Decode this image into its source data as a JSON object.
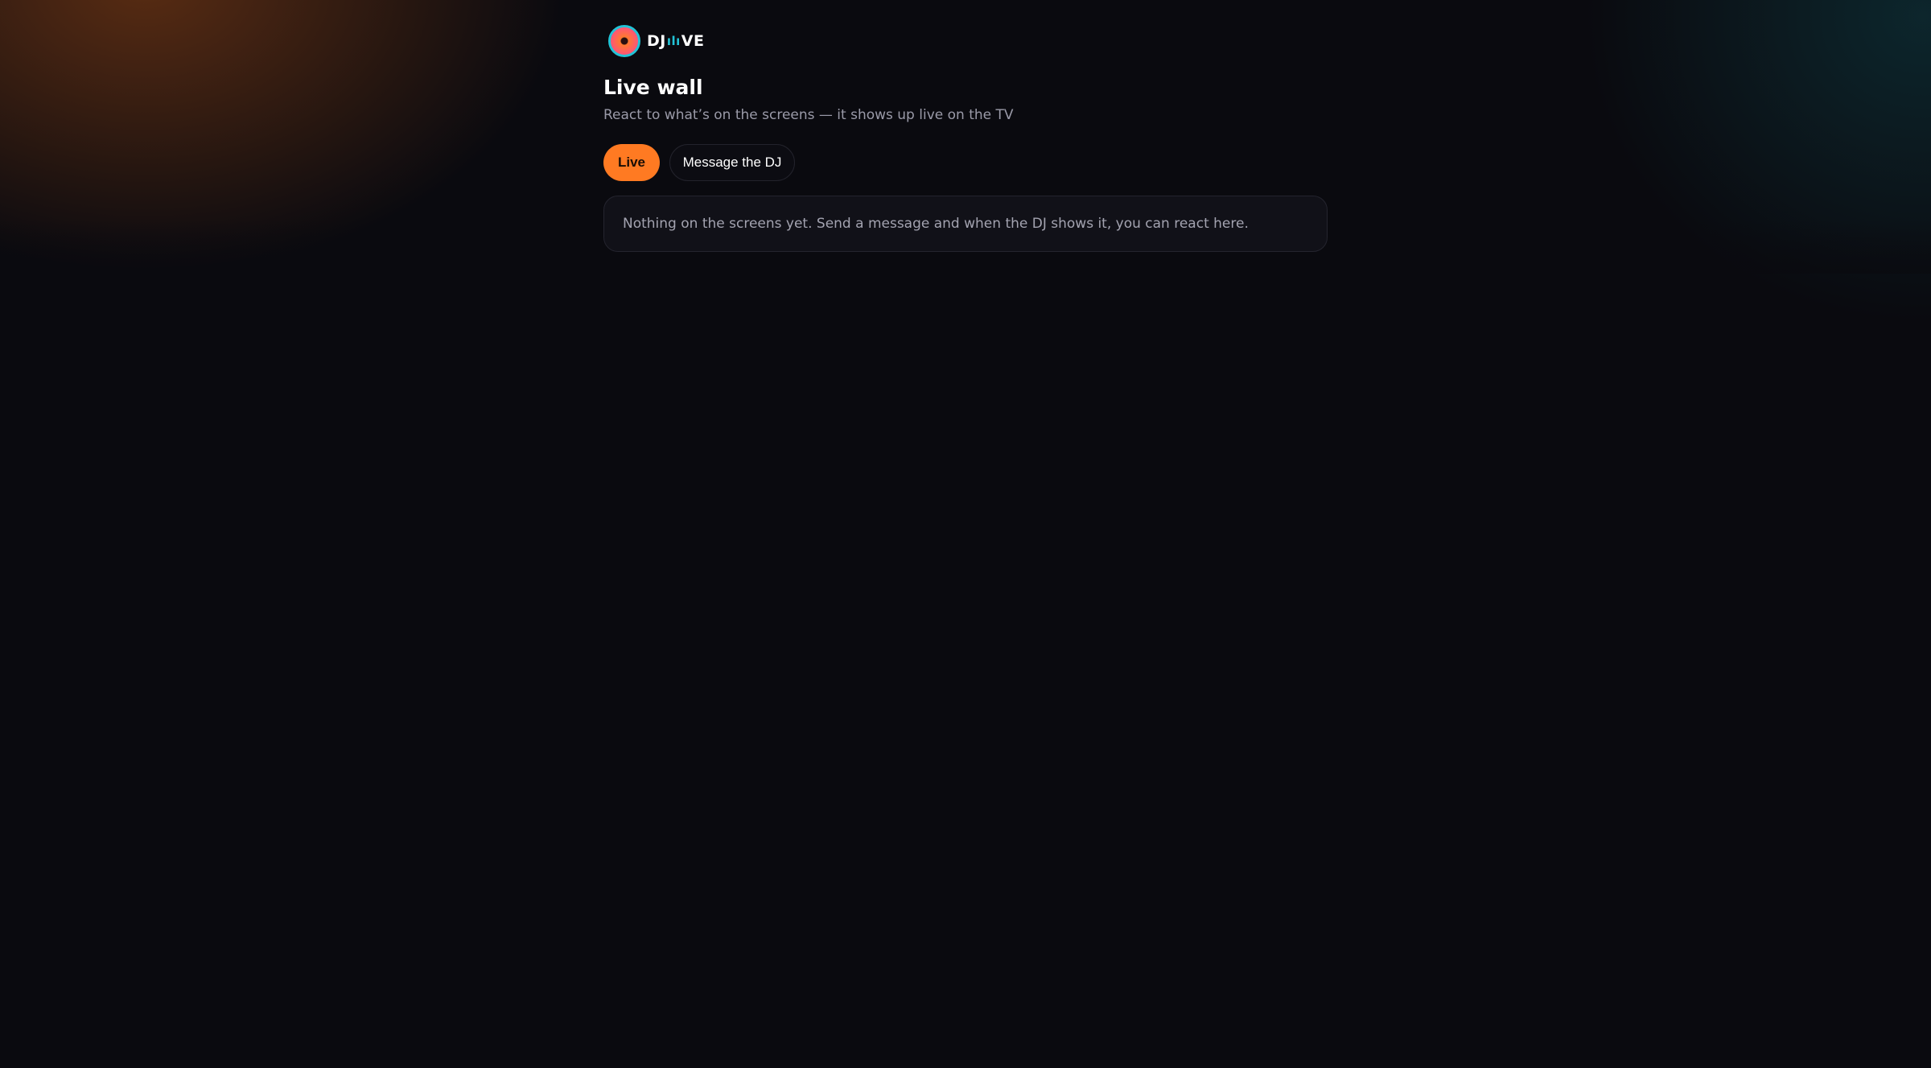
{
  "brand": {
    "logo_left": "DJ",
    "logo_mid": "ılı",
    "logo_right": "VE"
  },
  "header": {
    "title": "Live wall",
    "subtitle": "React to what’s on the screens — it shows up live on the TV"
  },
  "tabs": [
    {
      "label": "Live",
      "active": true
    },
    {
      "label": "Message the DJ",
      "active": false
    }
  ],
  "empty_state": {
    "message": "Nothing on the screens yet. Send a message and when the DJ shows it, you can react here."
  },
  "colors": {
    "accent": "#ff7a22",
    "logo_ring": "#22c3d6",
    "background": "#0a0a0f",
    "card": "#111118",
    "muted_text": "#9a9aa8"
  },
  "icons": {
    "logo": "vinyl-disc-icon"
  }
}
